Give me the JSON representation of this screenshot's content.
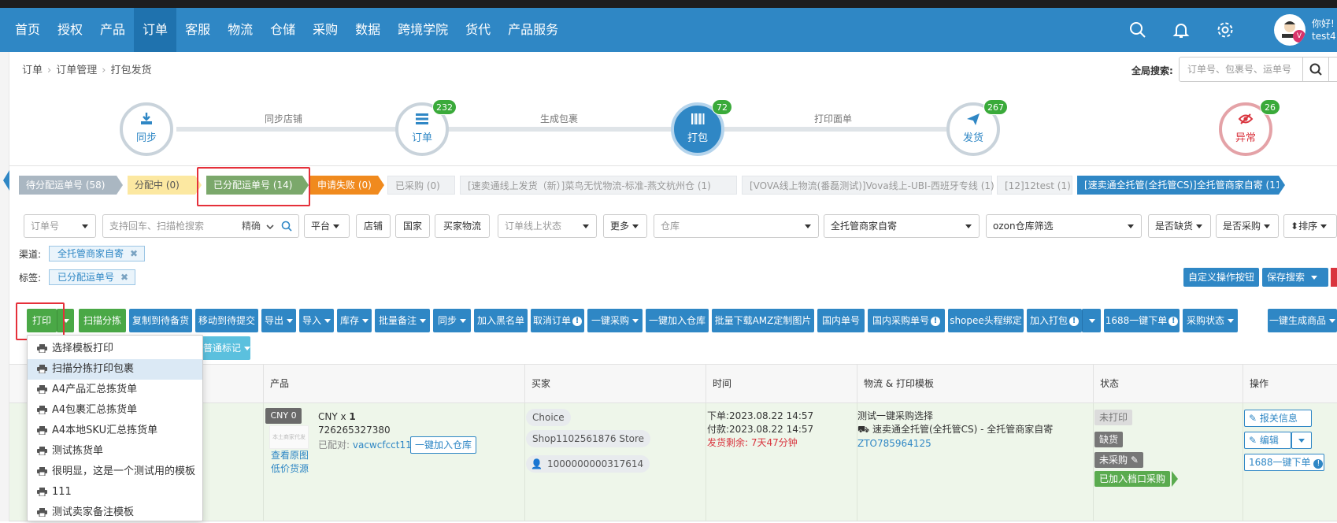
{
  "nav": {
    "items": [
      "首页",
      "授权",
      "产品",
      "订单",
      "客服",
      "物流",
      "仓储",
      "采购",
      "数据",
      "跨境学院",
      "货代",
      "产品服务"
    ],
    "active": "订单",
    "greeting_line1": "你好!",
    "greeting_line2": "test4",
    "avatar_badge": "V"
  },
  "breadcrumb": [
    "订单",
    "订单管理",
    "打包发货"
  ],
  "global_search": {
    "label": "全局搜索:",
    "placeholder": "订单号、包裹号、运单号"
  },
  "flow": {
    "steps": [
      {
        "label": "同步",
        "count": ""
      },
      {
        "label": "订单",
        "count": "232"
      },
      {
        "label": "打包",
        "count": "72"
      },
      {
        "label": "发货",
        "count": "267"
      },
      {
        "label": "异常",
        "count": "26"
      }
    ],
    "transitions": [
      "同步店铺",
      "生成包裹",
      "打印面单"
    ]
  },
  "status_tabs": [
    "待分配运单号 (58)",
    "分配中 (0)",
    "已分配运单号 (14)",
    "申请失败 (0)",
    "已采购 (0)",
    "[速卖通线上发货（新）]菜鸟无忧物流-标准-燕文杭州仓 (1)",
    "[VOVA线上物流(番磊测试)]Vova线上-UBI-西班牙专线 (1)",
    "[12]12test (1)",
    "[速卖通全托管(全托管CS)]全托管商家自寄 (11)"
  ],
  "filters": {
    "order_no": "订单号",
    "search_placeholder": "支持回车、扫描枪搜索",
    "match": "精确",
    "platform": "平台",
    "shop": "店铺",
    "country": "国家",
    "buyer_logistics": "买家物流",
    "online_status": "订单线上状态",
    "more": "更多",
    "warehouse": "仓库",
    "logistics_select": "全托管商家自寄",
    "ozon_filter": "ozon仓库筛选",
    "out_of_stock": "是否缺货",
    "purchased": "是否采购",
    "sort": "排序"
  },
  "channel": {
    "label": "渠道:",
    "value": "全托管商家自寄"
  },
  "tag": {
    "label": "标签:",
    "value": "已分配运单号"
  },
  "right_actions": {
    "custom": "自定义操作按钮",
    "save_search": "保存搜索"
  },
  "toolbar": {
    "print": "打印",
    "scan_sort": "扫描分拣",
    "copy_pending": "复制到待备货",
    "move_submit": "移动到待提交",
    "export": "导出",
    "import": "导入",
    "stock": "库存",
    "batch_note": "批量备注",
    "sync": "同步",
    "blacklist": "加入黑名单",
    "cancel_order": "取消订单",
    "one_click_purchase": "一键采购",
    "one_click_warehouse": "一键加入仓库",
    "amz_download": "批量下载AMZ定制图片",
    "domestic_no": "国内单号",
    "domestic_purchase_no": "国内采购单号",
    "shopee_bind": "shopee头程绑定",
    "add_pack": "加入打包",
    "order_1688": "1688一键下单",
    "purchase_status": "采购状态",
    "gen_product": "一键生成商品",
    "normal_mark": "普通标记"
  },
  "print_menu": [
    "选择模板打印",
    "扫描分拣打印包裹",
    "A4产品汇总拣货单",
    "A4包裹汇总拣货单",
    "A4本地SKU汇总拣货单",
    "测试拣货单",
    "很明显，这是一个测试用的模板",
    "111",
    "测试卖家备注模板"
  ],
  "table": {
    "headers": [
      "产品",
      "买家",
      "时间",
      "物流 & 打印模板",
      "状态",
      "操作"
    ],
    "row": {
      "cny_tag": "CNY 0",
      "thumb_text": "本土商家代发",
      "qty_prefix": "CNY x ",
      "qty": "1",
      "product_id": "726265327380",
      "paired_label": "已配对:",
      "paired_sku": "vacwcfcct113",
      "add_warehouse": "一键加入仓库",
      "view_image": "查看原图",
      "low_price": "低价货源",
      "buyer_choice": "Choice",
      "buyer_shop": "Shop1102561876 Store",
      "buyer_id": "1000000000317614",
      "order_time": "下单:2023.08.22 14:57",
      "pay_time": "付款:2023.08.22 14:57",
      "remaining": "发货剩余: 7天47分钟",
      "logistics_title": "测试一键采购选择",
      "logistics_channel": "速卖通全托管(全托管CS) - 全托管商家自寄",
      "tracking": "ZTO785964125",
      "status_unprinted": "未打印",
      "status_short": "缺货",
      "status_unpurchased": "未采购",
      "status_stall": "已加入档口采购",
      "op_report": "报关信息",
      "op_edit": "编辑",
      "op_1688": "1688一键下单"
    }
  },
  "colors": {
    "primary": "#2f87c5",
    "green": "#4aa846",
    "highlight_red": "#e5303a"
  }
}
